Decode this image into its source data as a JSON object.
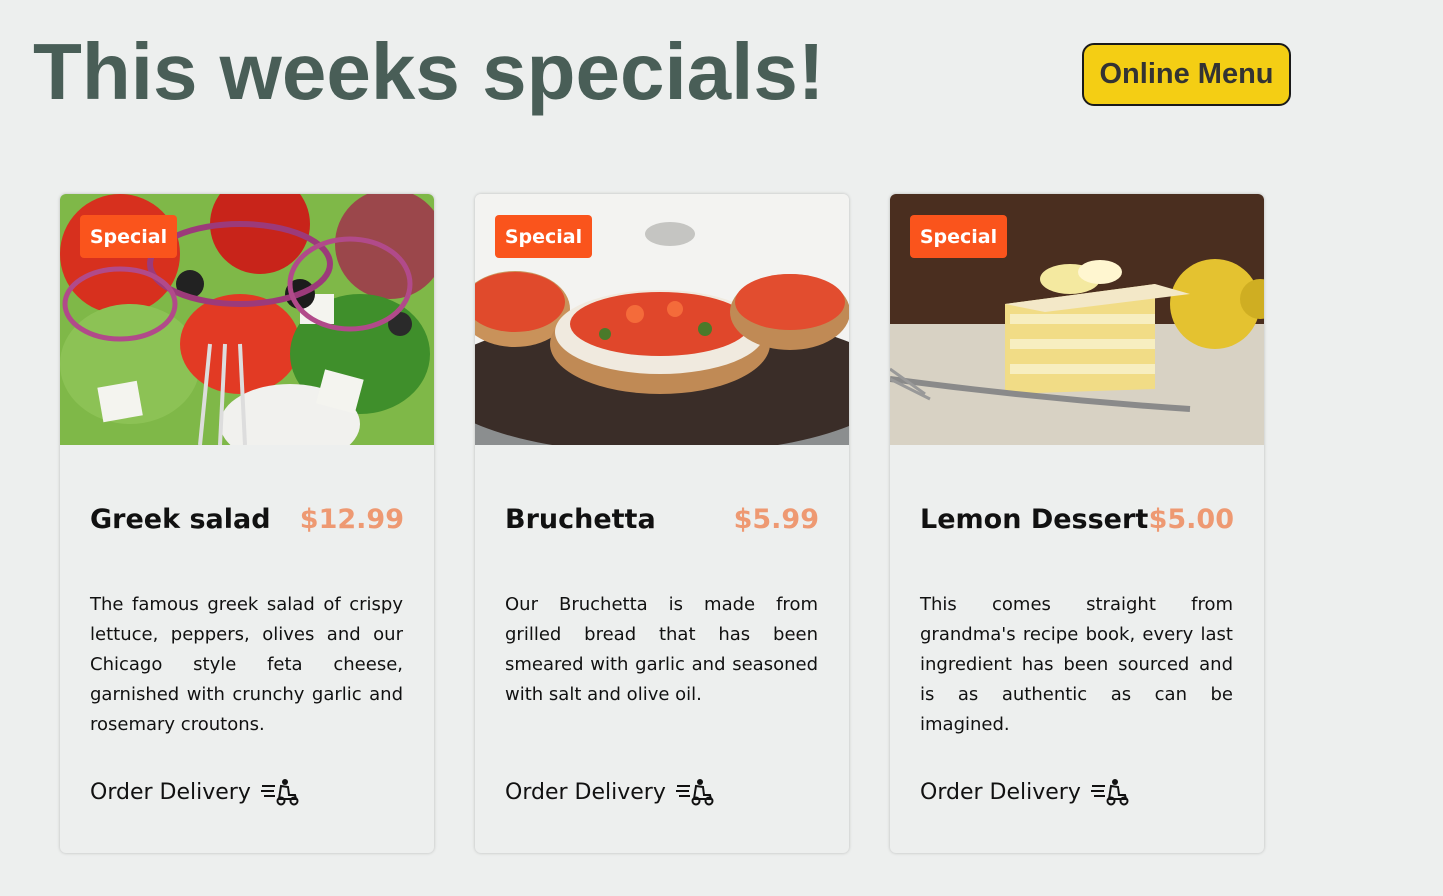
{
  "header": {
    "title": "This weeks specials!",
    "menu_button": "Online Menu"
  },
  "cards": [
    {
      "badge": "Special",
      "title": "Greek salad",
      "price": "$12.99",
      "description": "The famous greek salad of crispy lettuce, peppers, olives and our Chicago style feta cheese, garnished with crunchy garlic and rosemary croutons.",
      "order_label": "Order Delivery",
      "order_icon": "delivery-scooter-icon"
    },
    {
      "badge": "Special",
      "title": "Bruchetta",
      "price": "$5.99",
      "description": "Our Bruchetta is made from grilled bread that has been smeared with garlic and seasoned with salt and olive oil.",
      "order_label": "Order Delivery",
      "order_icon": "delivery-scooter-icon"
    },
    {
      "badge": "Special",
      "title": "Lemon Dessert",
      "price": "$5.00",
      "description": "This comes straight from grandma's recipe book, every last ingredient has been sourced and is as authentic as can be imagined.",
      "order_label": "Order Delivery",
      "order_icon": "delivery-scooter-icon"
    }
  ],
  "colors": {
    "background": "#edefee",
    "heading": "#495e57",
    "menu_button": "#f4ce14",
    "badge": "#fa541c",
    "price": "#ee9972"
  }
}
